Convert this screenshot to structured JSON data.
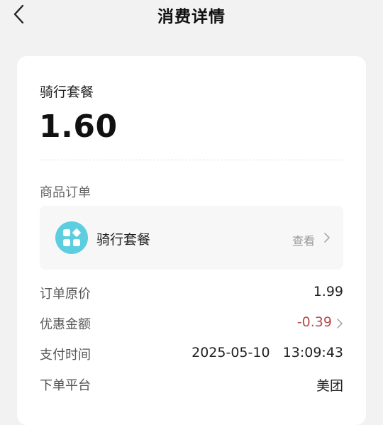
{
  "header": {
    "title": "消费详情",
    "back_icon": "chevron-left-icon"
  },
  "summary": {
    "product_name": "骑行套餐",
    "amount": "1.60"
  },
  "order_section": {
    "label": "商品订单",
    "item": {
      "icon": "grid-apps-icon",
      "icon_color": "#5dcde0",
      "name": "骑行套餐",
      "view_label": "查看"
    }
  },
  "details": [
    {
      "label": "订单原价",
      "value": "1.99"
    },
    {
      "label": "优惠金额",
      "value": "-0.39",
      "value_color": "#b84a4a"
    },
    {
      "label": "支付时间",
      "value": "2025-05-10   13:09:43"
    },
    {
      "label": "下单平台",
      "value": "美团"
    }
  ]
}
